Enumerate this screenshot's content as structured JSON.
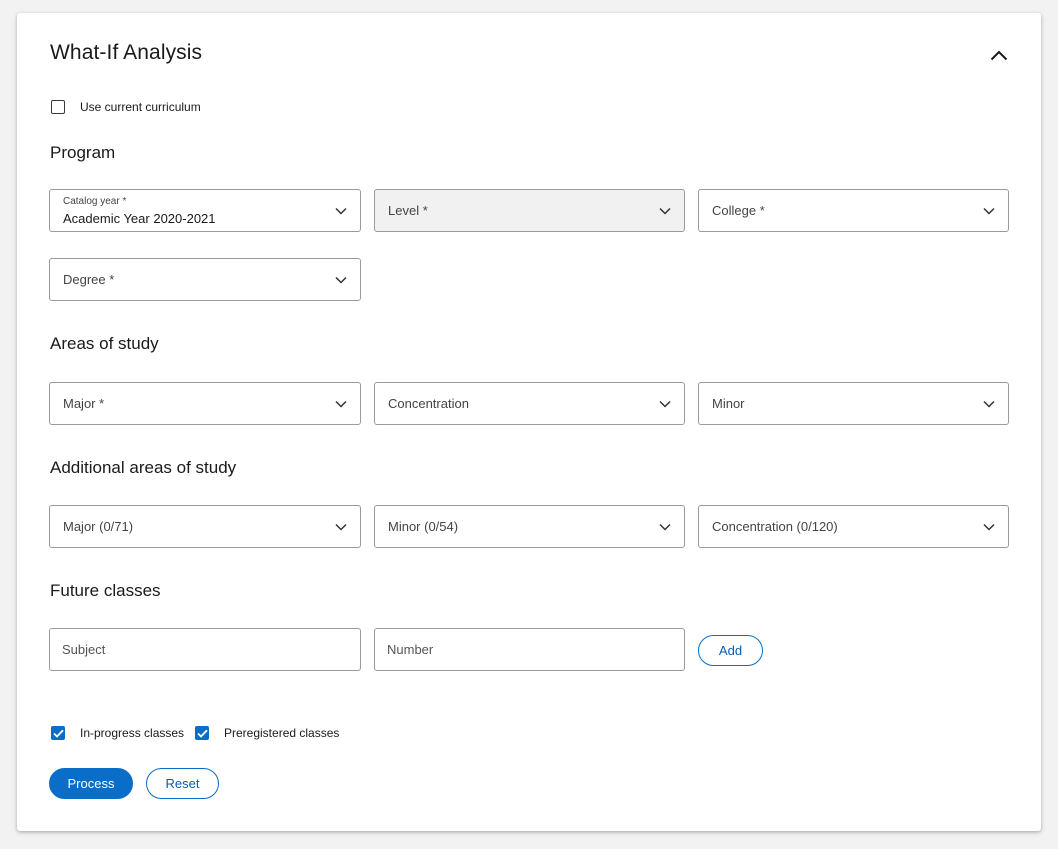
{
  "panel": {
    "title": "What-If Analysis"
  },
  "use_current_curriculum": {
    "label": "Use current curriculum",
    "checked": false
  },
  "program": {
    "heading": "Program",
    "catalog_year": {
      "label": "Catalog year *",
      "value": "Academic Year 2020-2021"
    },
    "level": {
      "label": "Level *"
    },
    "college": {
      "label": "College *"
    },
    "degree": {
      "label": "Degree *"
    }
  },
  "areas_of_study": {
    "heading": "Areas of study",
    "major": {
      "label": "Major *"
    },
    "concentration": {
      "label": "Concentration"
    },
    "minor": {
      "label": "Minor"
    }
  },
  "additional_areas": {
    "heading": "Additional areas of study",
    "major": {
      "label": "Major (0/71)"
    },
    "minor": {
      "label": "Minor (0/54)"
    },
    "concentration": {
      "label": "Concentration (0/120)"
    }
  },
  "future_classes": {
    "heading": "Future classes",
    "subject_placeholder": "Subject",
    "number_placeholder": "Number",
    "add_label": "Add"
  },
  "options": {
    "in_progress": {
      "label": "In-progress classes",
      "checked": true
    },
    "preregistered": {
      "label": "Preregistered classes",
      "checked": true
    }
  },
  "actions": {
    "process_label": "Process",
    "reset_label": "Reset"
  },
  "colors": {
    "accent": "#0a6ec8",
    "border": "#9a9a9a",
    "disabled_bg": "#f1f1f1"
  },
  "icons": {
    "collapse": "chevron-up-icon",
    "dropdown": "chevron-down-icon",
    "check": "check-icon"
  }
}
